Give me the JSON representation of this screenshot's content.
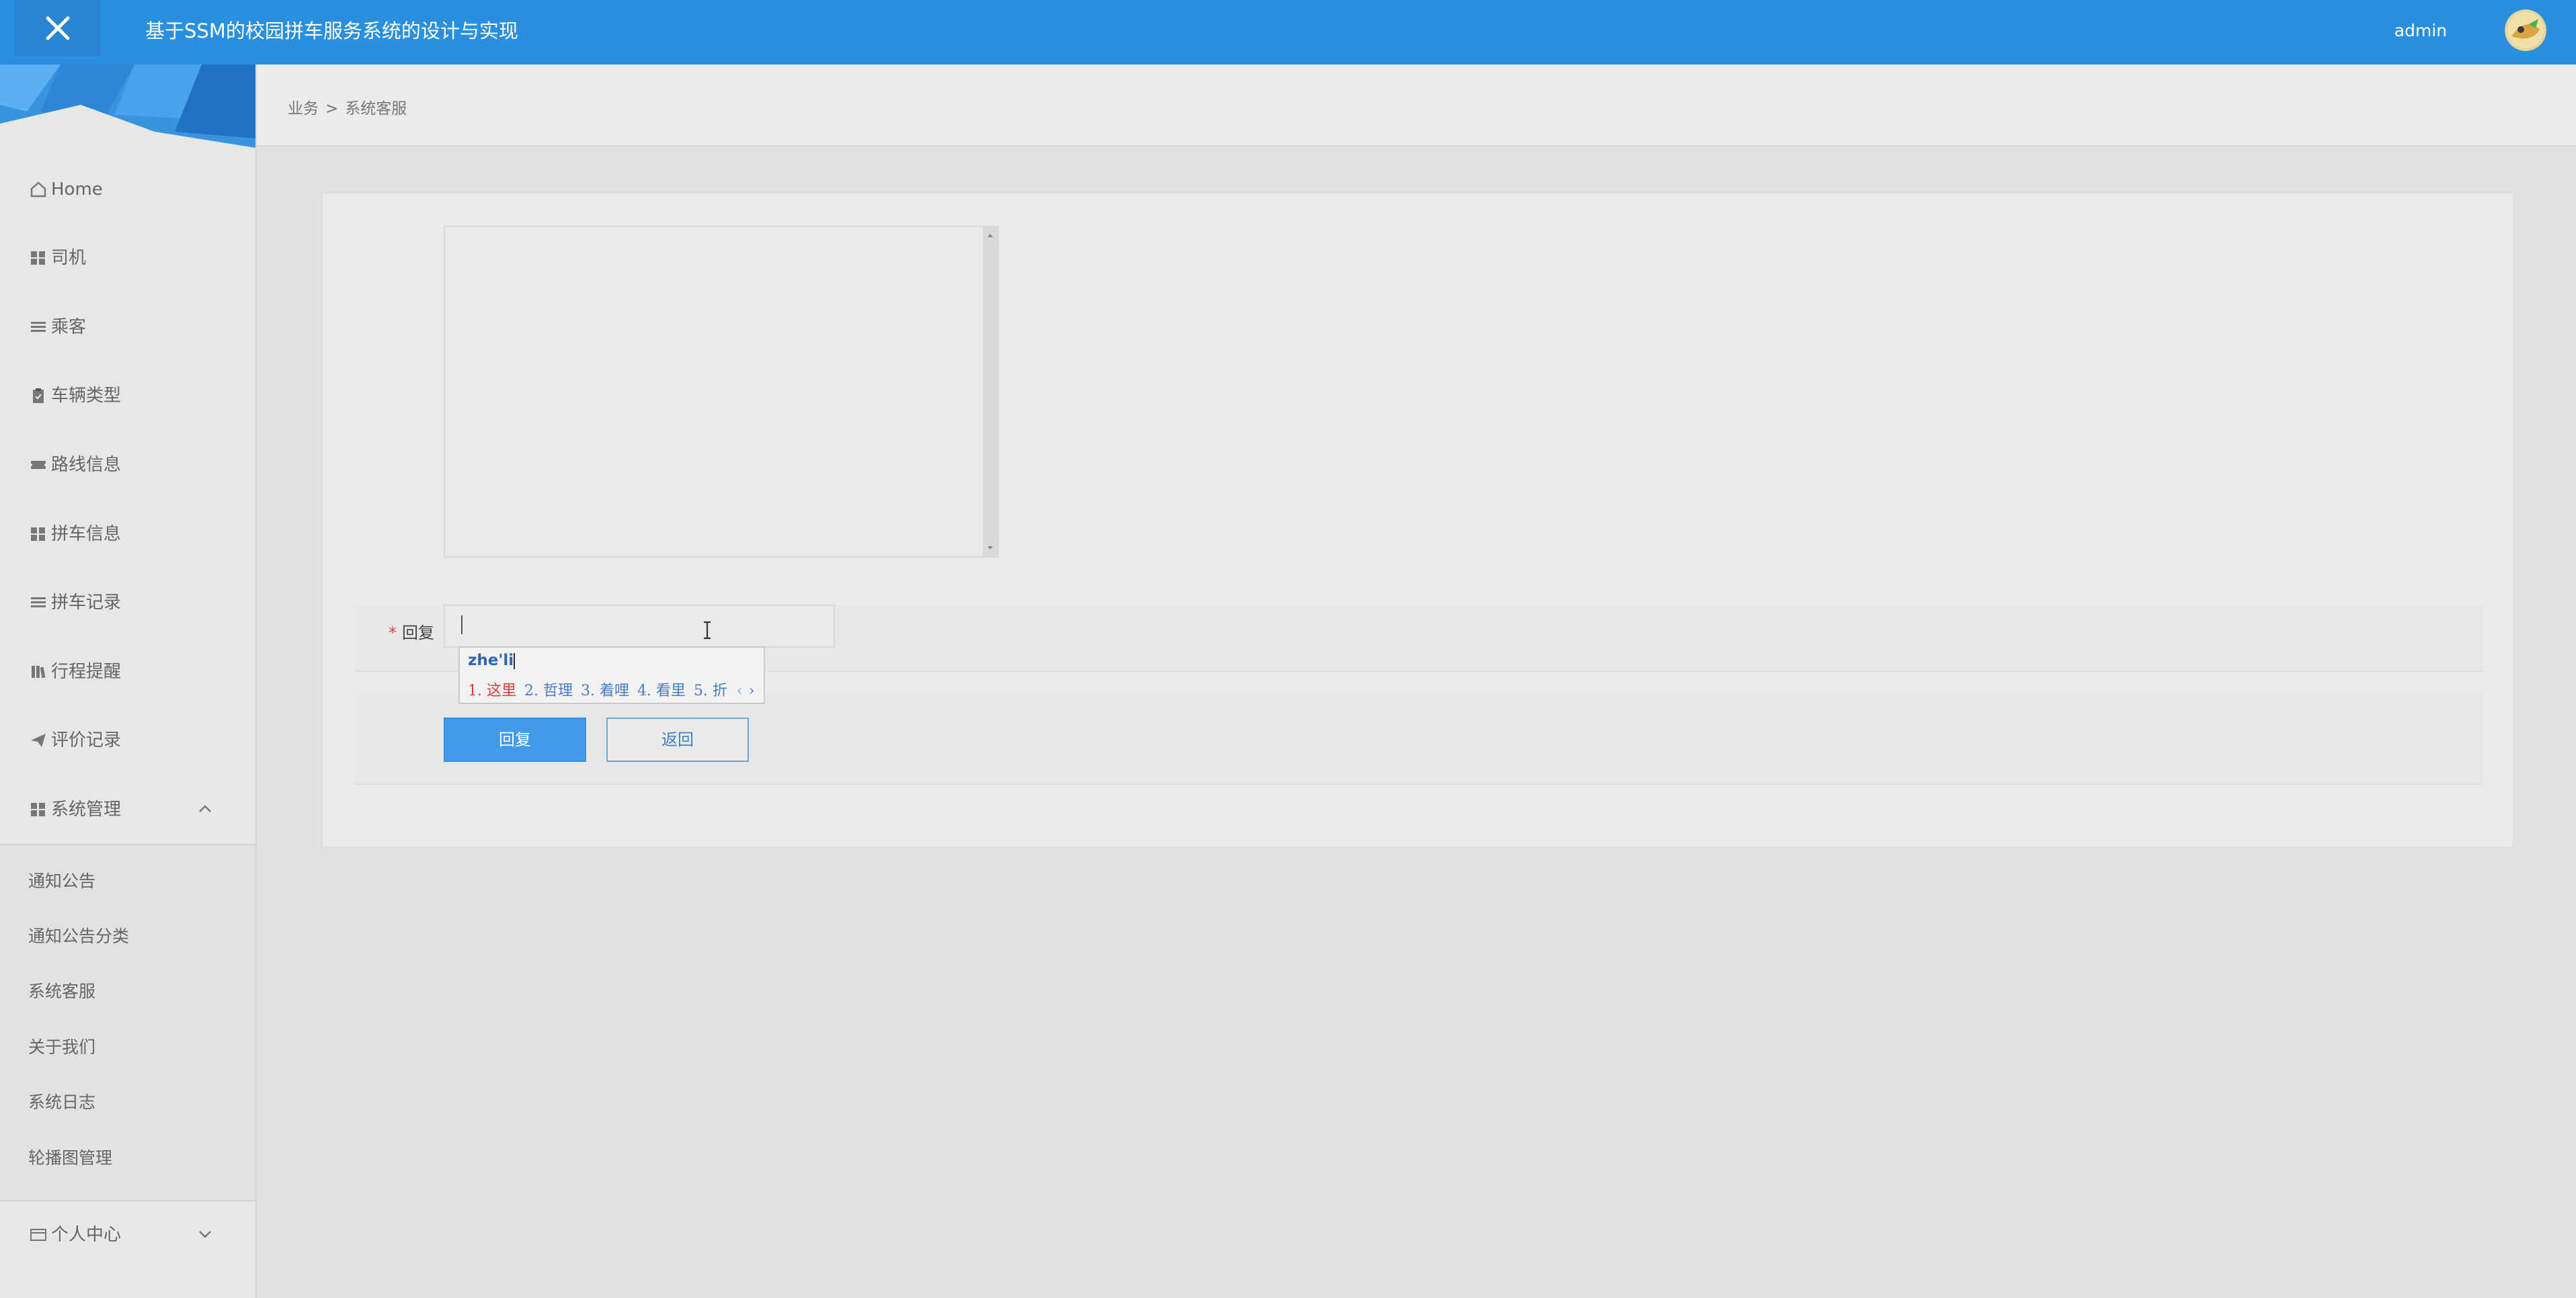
{
  "app": {
    "title": "基于SSM的校园拼车服务系统的设计与实现",
    "user": "admin"
  },
  "breadcrumb": {
    "root": "业务",
    "separator": ">",
    "current": "系统客服"
  },
  "sidebar": {
    "items": [
      {
        "label": "Home",
        "icon": "home-icon"
      },
      {
        "label": "司机",
        "icon": "grid-icon"
      },
      {
        "label": "乘客",
        "icon": "list-icon"
      },
      {
        "label": "车辆类型",
        "icon": "clipboard-icon"
      },
      {
        "label": "路线信息",
        "icon": "ticket-icon"
      },
      {
        "label": "拼车信息",
        "icon": "grid-icon"
      },
      {
        "label": "拼车记录",
        "icon": "list-icon"
      },
      {
        "label": "行程提醒",
        "icon": "book-icon"
      },
      {
        "label": "评价记录",
        "icon": "send-icon"
      },
      {
        "label": "系统管理",
        "icon": "grid-icon"
      }
    ],
    "submenu": [
      "通知公告",
      "通知公告分类",
      "系统客服",
      "关于我们",
      "系统日志",
      "轮播图管理"
    ],
    "personal_center": {
      "label": "个人中心",
      "icon": "card-icon"
    }
  },
  "form": {
    "reply_label": "回复",
    "required_mark": "*",
    "reply_value": "",
    "buttons": {
      "submit": "回复",
      "back": "返回"
    }
  },
  "ime": {
    "composition": "zhe'li",
    "candidates": [
      "1. 这里",
      "2. 哲理",
      "3. 着哩",
      "4. 看里",
      "5. 折"
    ],
    "prev": "‹",
    "next": "›"
  },
  "colors": {
    "topbar": "#2b8fe0",
    "primary": "#4399ea",
    "required": "#e04040"
  }
}
